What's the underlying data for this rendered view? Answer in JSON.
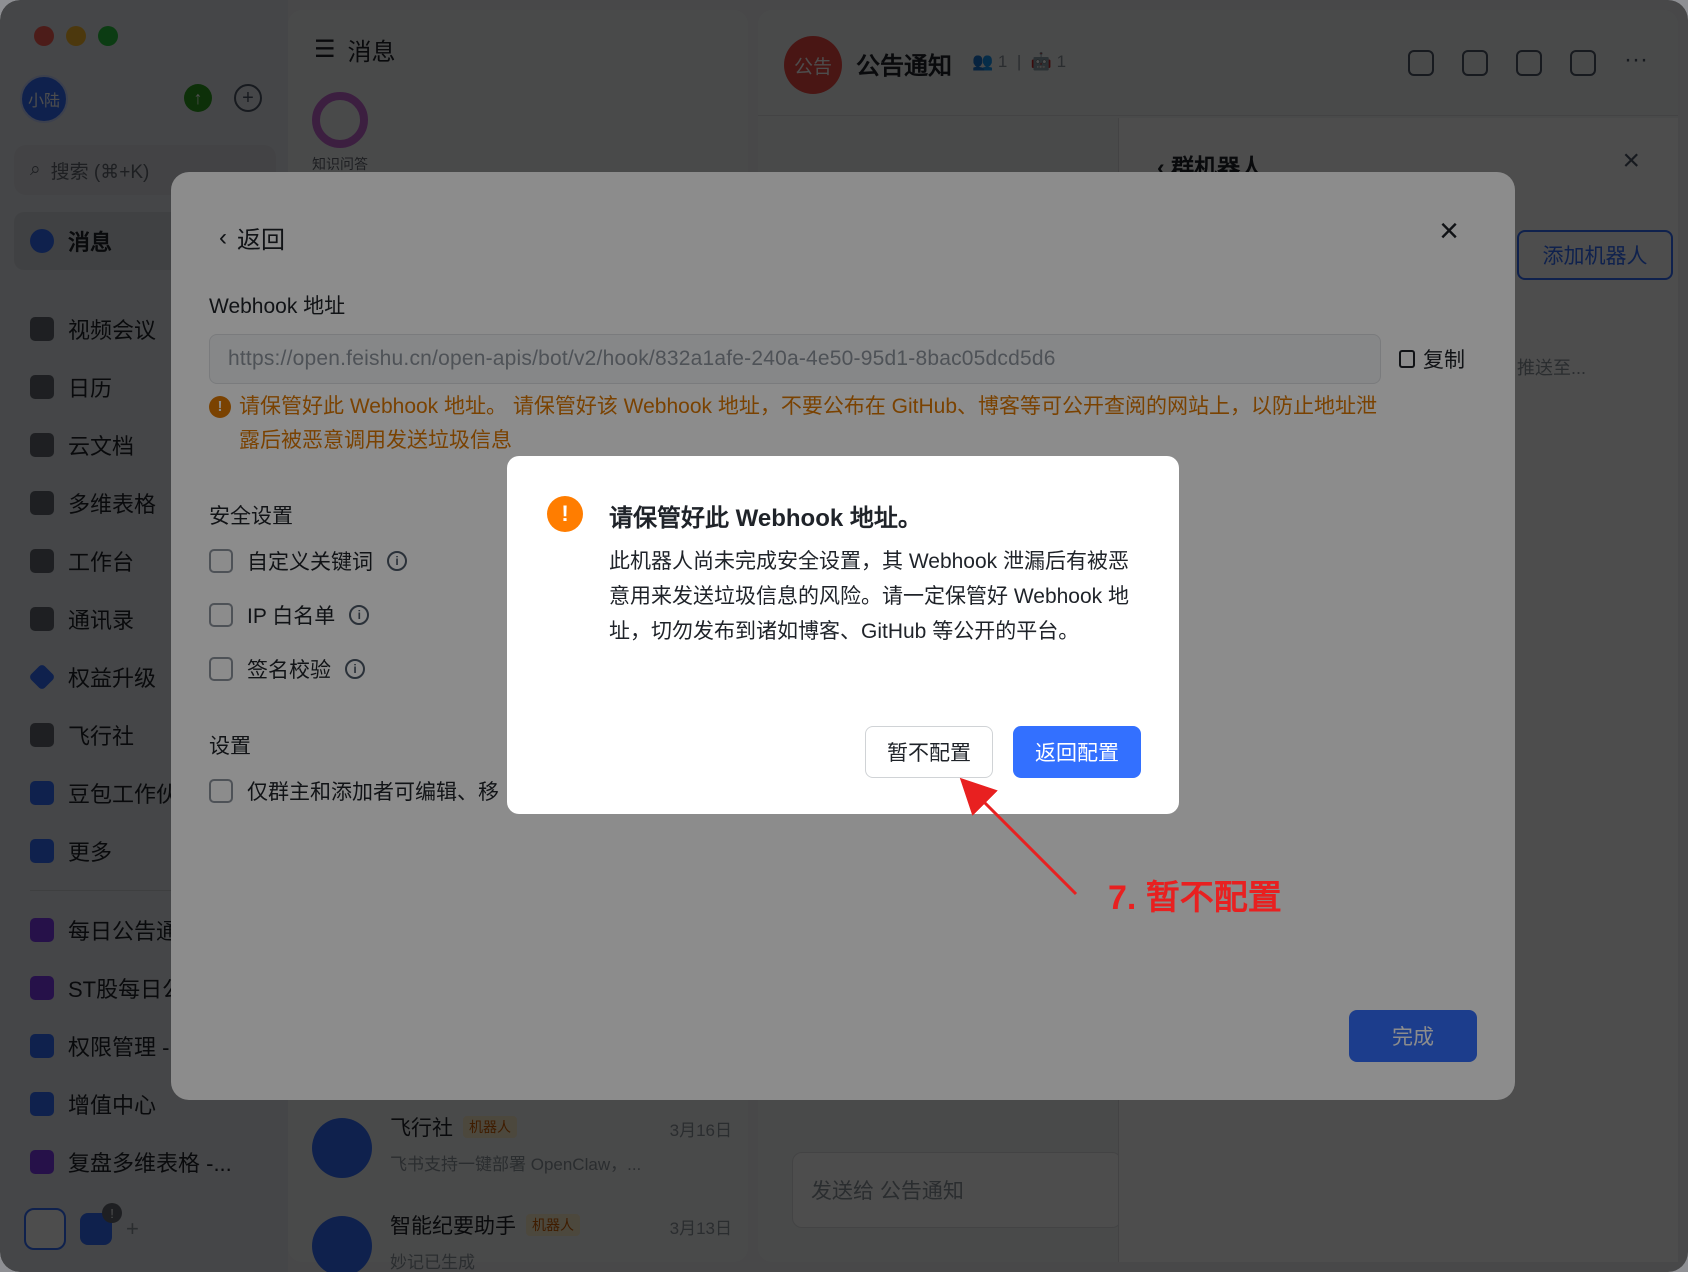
{
  "sidebar": {
    "avatar_text": "小陆",
    "search_placeholder": "搜索 (⌘+K)",
    "nav": [
      {
        "label": "消息",
        "icon": "message-icon"
      },
      {
        "label": "视频会议",
        "icon": "video-icon"
      },
      {
        "label": "日历",
        "icon": "calendar-icon"
      },
      {
        "label": "云文档",
        "icon": "docs-icon"
      },
      {
        "label": "多维表格",
        "icon": "base-icon"
      },
      {
        "label": "工作台",
        "icon": "workplace-icon"
      },
      {
        "label": "通讯录",
        "icon": "contacts-icon"
      },
      {
        "label": "权益升级",
        "icon": "diamond-icon"
      },
      {
        "label": "飞行社",
        "icon": "book-icon"
      },
      {
        "label": "豆包工作伙",
        "icon": "doubao-icon"
      },
      {
        "label": "更多",
        "icon": "more-apps-icon"
      }
    ],
    "pinned": [
      {
        "label": "每日公告通"
      },
      {
        "label": "ST股每日公"
      },
      {
        "label": "权限管理 -"
      },
      {
        "label": "增值中心"
      },
      {
        "label": "复盘多维表格 -..."
      }
    ],
    "badge": "!"
  },
  "message_list": {
    "title": "消息",
    "kqa_label": "知识问答",
    "chats": [
      {
        "name": "飞行社",
        "tag": "机器人",
        "date": "3月16日",
        "preview": "飞书支持一键部署 OpenClaw，..."
      },
      {
        "name": "智能纪要助手",
        "tag": "机器人",
        "date": "3月13日",
        "preview": "妙记已生成"
      }
    ]
  },
  "chat": {
    "group_avatar": "公告",
    "group_name": "公告通知",
    "members": "1",
    "bots": "1",
    "input_placeholder": "发送给 公告通知"
  },
  "drawer": {
    "title": "群机器人",
    "add_button": "添加机器人",
    "hint": "推送至..."
  },
  "config": {
    "back_label": "返回",
    "webhook_label": "Webhook 地址",
    "webhook_url": "https://open.feishu.cn/open-apis/bot/v2/hook/832a1afe-240a-4e50-95d1-8bac05dcd5d6",
    "copy_label": "复制",
    "warning": "请保管好此 Webhook 地址。 请保管好该 Webhook 地址，不要公布在 GitHub、博客等可公开查阅的网站上，以防止地址泄露后被恶意调用发送垃圾信息",
    "security_label": "安全设置",
    "security_options": [
      "自定义关键词",
      "IP 白名单",
      "签名校验"
    ],
    "settings_label": "设置",
    "settings_option": "仅群主和添加者可编辑、移",
    "done_button": "完成"
  },
  "alert": {
    "title": "请保管好此 Webhook 地址。",
    "body": "此机器人尚未完成安全设置，其 Webhook 泄漏后有被恶意用来发送垃圾信息的风险。请一定保管好 Webhook 地址，切勿发布到诸如博客、GitHub 等公开的平台。",
    "cancel_button": "暂不配置",
    "confirm_button": "返回配置"
  },
  "annotation": {
    "text": "7. 暂不配置",
    "color": "#e82020"
  },
  "colors": {
    "accent": "#3370ff",
    "warning": "#de7802",
    "alert_icon": "#ff7d00"
  }
}
